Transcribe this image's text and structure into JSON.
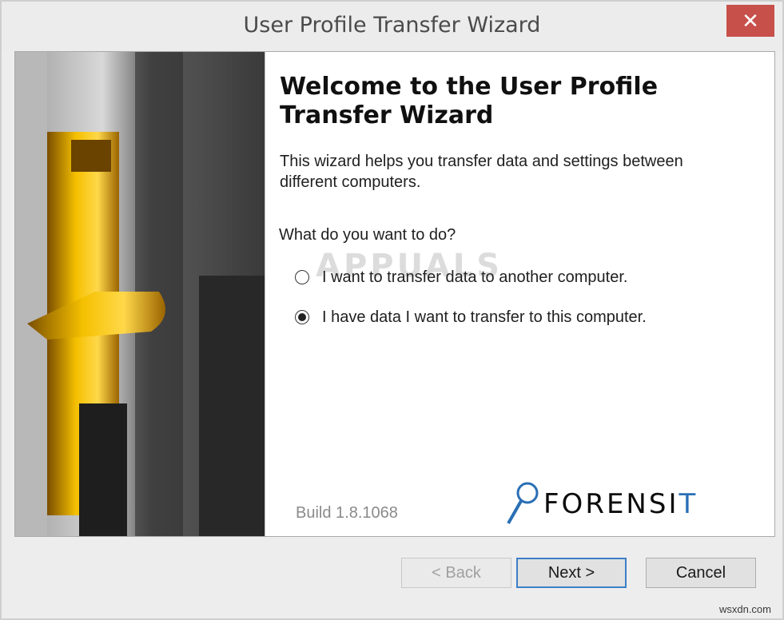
{
  "window": {
    "title": "User Profile Transfer Wizard",
    "close_glyph": "✕"
  },
  "wizard": {
    "heading": "Welcome to the User Profile Transfer Wizard",
    "description": "This wizard helps you transfer data and settings between different computers.",
    "question": "What do you want to do?",
    "options": [
      {
        "label": "I want to transfer data to another computer.",
        "selected": false
      },
      {
        "label": "I have data I want to transfer to this computer.",
        "selected": true
      }
    ],
    "build": "Build 1.8.1068",
    "logo_text_main": "FORENSI",
    "logo_text_accent": "T"
  },
  "buttons": {
    "back": "< Back",
    "next": "Next >",
    "cancel": "Cancel"
  },
  "watermark": "APPUALS",
  "site_mark": "wsxdn.com",
  "colors": {
    "close_button": "#c7504b",
    "default_button_border": "#3c7fc8",
    "door_handle_gold": "#e0a400"
  }
}
